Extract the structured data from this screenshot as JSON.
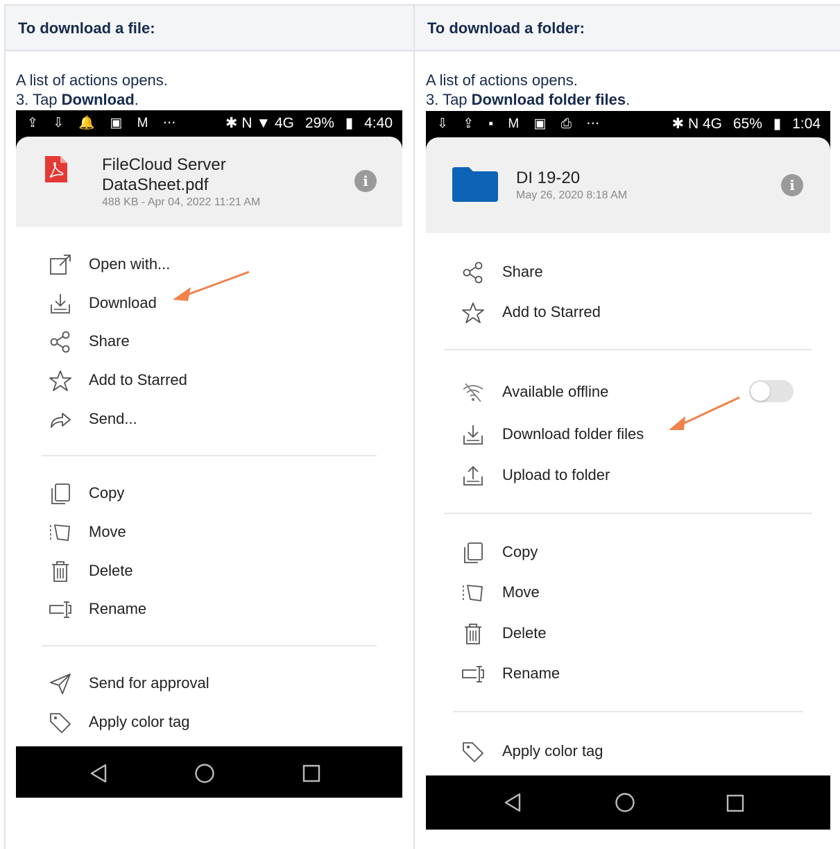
{
  "table": {
    "left_header": "To download a file:",
    "right_header": "To download a folder:"
  },
  "left": {
    "intro_line1": "A list of actions opens.",
    "intro_step_prefix": "3. Tap ",
    "intro_step_bold": "Download",
    "intro_step_suffix": ".",
    "status": {
      "icons": "⇪ ⇩ 🔔 ▣ M ⋯",
      "right_icons": "✱ N ▼ 4G",
      "battery": "29%",
      "time": "4:40"
    },
    "file": {
      "title_line1": "FileCloud Server",
      "title_line2": "DataSheet.pdf",
      "meta": "488 KB - Apr 04, 2022 11:21 AM"
    },
    "menu": [
      {
        "icon": "open-external-icon",
        "label": "Open with..."
      },
      {
        "icon": "download-icon",
        "label": "Download"
      },
      {
        "icon": "share-icon",
        "label": "Share"
      },
      {
        "icon": "star-icon",
        "label": "Add to Starred"
      },
      {
        "icon": "send-icon",
        "label": "Send..."
      },
      {
        "icon": "copy-icon",
        "label": "Copy"
      },
      {
        "icon": "move-icon",
        "label": "Move"
      },
      {
        "icon": "trash-icon",
        "label": "Delete"
      },
      {
        "icon": "rename-icon",
        "label": "Rename"
      },
      {
        "icon": "paper-plane-icon",
        "label": "Send for approval"
      },
      {
        "icon": "tag-icon",
        "label": "Apply color tag"
      }
    ]
  },
  "right": {
    "intro_line1": "A list of actions opens.",
    "intro_step_prefix": "3. Tap ",
    "intro_step_bold": "Download folder files",
    "intro_step_suffix": ".",
    "status": {
      "icons": "⇩ ⇪ ▪ M ▣ ⎙ ⋯",
      "right_icons": "✱ N 4G",
      "battery": "65%",
      "time": "1:04"
    },
    "folder": {
      "title": "DI 19-20",
      "meta": "May 26, 2020 8:18 AM"
    },
    "menu": [
      {
        "icon": "share-icon",
        "label": "Share"
      },
      {
        "icon": "star-icon",
        "label": "Add to Starred"
      },
      {
        "icon": "offline-icon",
        "label": "Available offline",
        "toggle": false
      },
      {
        "icon": "download-icon",
        "label": "Download folder files"
      },
      {
        "icon": "upload-icon",
        "label": "Upload to folder"
      },
      {
        "icon": "copy-icon",
        "label": "Copy"
      },
      {
        "icon": "move-icon",
        "label": "Move"
      },
      {
        "icon": "trash-icon",
        "label": "Delete"
      },
      {
        "icon": "rename-icon",
        "label": "Rename"
      },
      {
        "icon": "tag-icon",
        "label": "Apply color tag"
      }
    ]
  },
  "colors": {
    "arrow": "#f0824b",
    "header_bg": "#f4f5f7",
    "folder": "#0d63b5",
    "pdf": "#e53935"
  }
}
